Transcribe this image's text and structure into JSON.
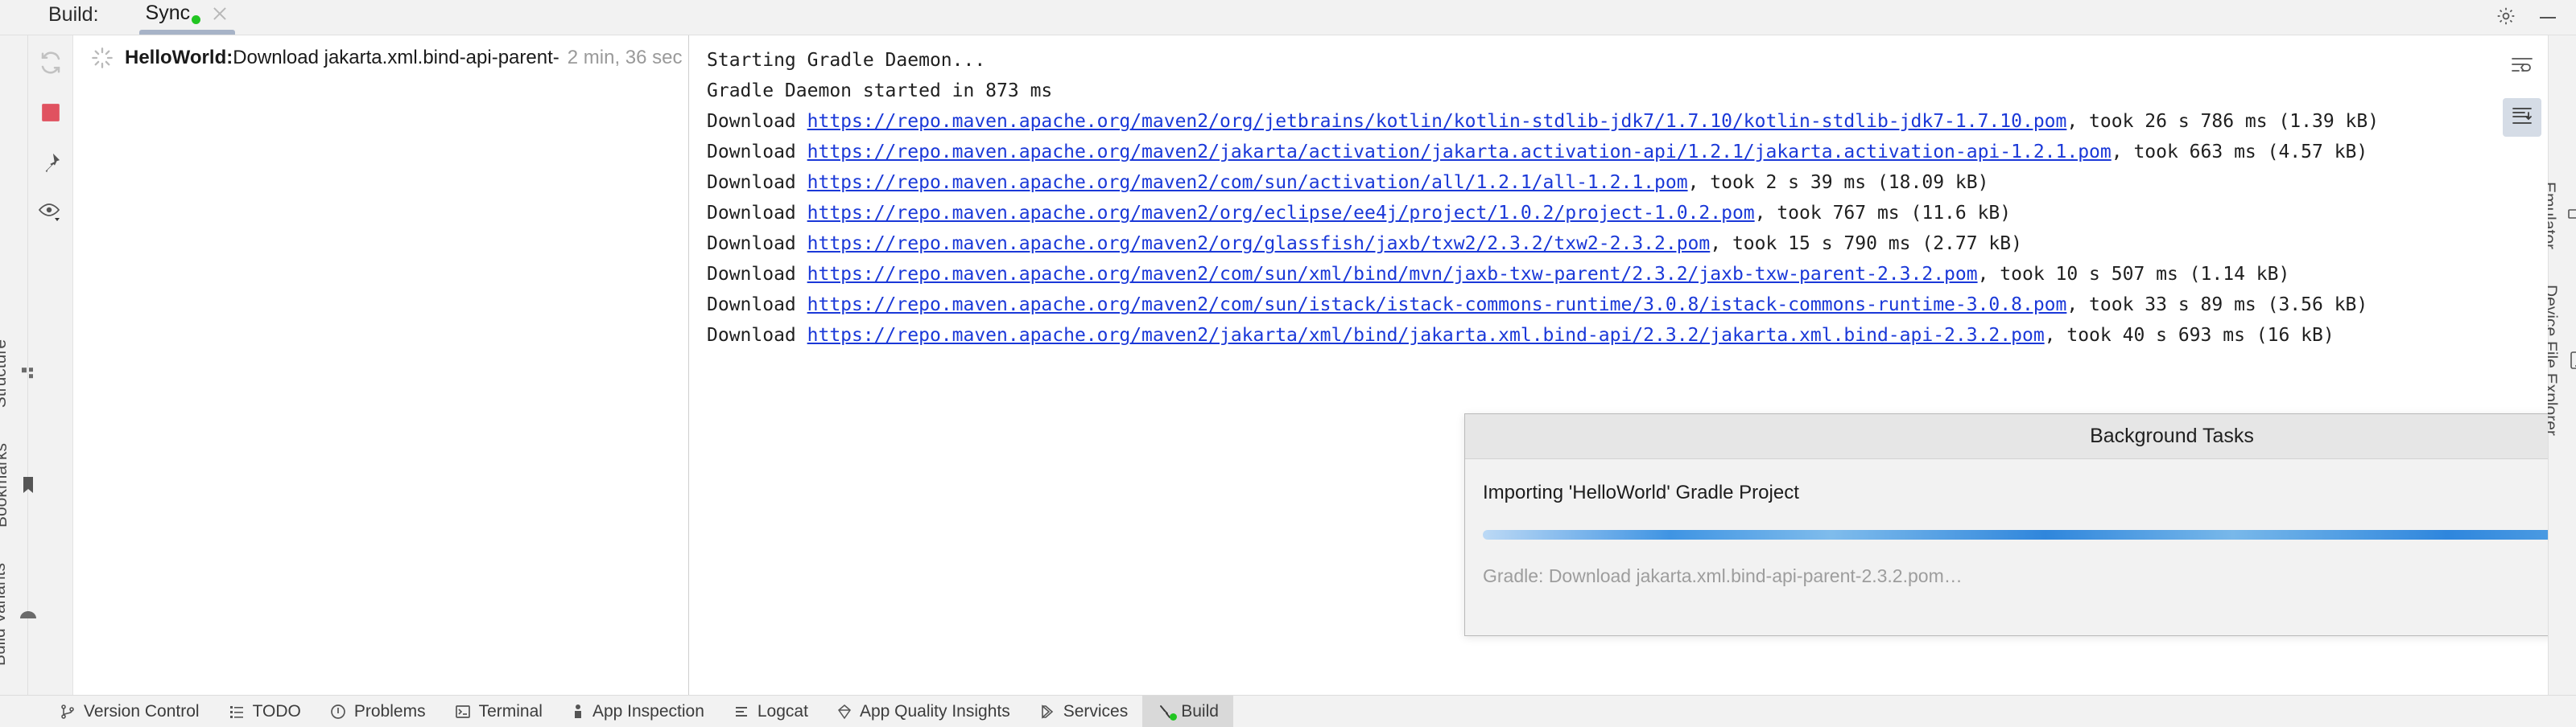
{
  "window": {
    "title_label": "Build:",
    "gear_icon": "gear-icon",
    "minimize_icon": "minimize-icon"
  },
  "tabs": [
    {
      "label": "Sync",
      "status": "running",
      "status_color": "#21c521",
      "close_icon": "close-icon",
      "active": true
    }
  ],
  "build_toolbar": [
    {
      "name": "restart-button",
      "icon": "restart-icon",
      "label": "Restart"
    },
    {
      "name": "stop-button",
      "icon": "stop-icon",
      "label": "Stop",
      "color": "#e05260"
    },
    {
      "name": "pin-button",
      "icon": "pin-icon",
      "label": "Pin Tab"
    },
    {
      "name": "filter-button",
      "icon": "eye-dropdown-icon",
      "label": "Show/Hide"
    }
  ],
  "tree": {
    "rows": [
      {
        "icon": "spinner-icon",
        "bold_text": "HelloWorld:",
        "text": " Download jakarta.xml.bind-api-parent-",
        "time": "2 min, 36 sec"
      }
    ]
  },
  "console": {
    "lines": [
      {
        "type": "plain",
        "text": "Starting Gradle Daemon..."
      },
      {
        "type": "plain",
        "text": "Gradle Daemon started in 873 ms"
      },
      {
        "type": "download",
        "prefix": "Download ",
        "url": "https://repo.maven.apache.org/maven2/org/jetbrains/kotlin/kotlin-stdlib-jdk7/1.7.10/kotlin-stdlib-jdk7-1.7.10.pom",
        "suffix": ", took 26 s 786 ms (1.39 kB)"
      },
      {
        "type": "download",
        "prefix": "Download ",
        "url": "https://repo.maven.apache.org/maven2/jakarta/activation/jakarta.activation-api/1.2.1/jakarta.activation-api-1.2.1.pom",
        "suffix": ", took 663 ms (4.57 kB)"
      },
      {
        "type": "download",
        "prefix": "Download ",
        "url": "https://repo.maven.apache.org/maven2/com/sun/activation/all/1.2.1/all-1.2.1.pom",
        "suffix": ", took 2 s 39 ms (18.09 kB)"
      },
      {
        "type": "download",
        "prefix": "Download ",
        "url": "https://repo.maven.apache.org/maven2/org/eclipse/ee4j/project/1.0.2/project-1.0.2.pom",
        "suffix": ", took 767 ms (11.6 kB)"
      },
      {
        "type": "download",
        "prefix": "Download ",
        "url": "https://repo.maven.apache.org/maven2/org/glassfish/jaxb/txw2/2.3.2/txw2-2.3.2.pom",
        "suffix": ", took 15 s 790 ms (2.77 kB)"
      },
      {
        "type": "download",
        "prefix": "Download ",
        "url": "https://repo.maven.apache.org/maven2/com/sun/xml/bind/mvn/jaxb-txw-parent/2.3.2/jaxb-txw-parent-2.3.2.pom",
        "suffix": ", took 10 s 507 ms (1.14 kB)"
      },
      {
        "type": "download",
        "prefix": "Download ",
        "url": "https://repo.maven.apache.org/maven2/com/sun/istack/istack-commons-runtime/3.0.8/istack-commons-runtime-3.0.8.pom",
        "suffix": ", took 33 s 89 ms (3.56 kB)"
      },
      {
        "type": "download",
        "prefix": "Download ",
        "url": "https://repo.maven.apache.org/maven2/jakarta/xml/bind/jakarta.xml.bind-api/2.3.2/jakarta.xml.bind-api-2.3.2.pom",
        "suffix": ", took 40 s 693 ms (16 kB)"
      }
    ],
    "right_toolbar": [
      {
        "name": "soft-wrap-button",
        "icon": "soft-wrap-icon",
        "selected": false
      },
      {
        "name": "scroll-to-end-button",
        "icon": "scroll-to-end-icon",
        "selected": true
      }
    ]
  },
  "background_tasks": {
    "title": "Background Tasks",
    "minimize_icon": "minimize-icon",
    "task_name": "Importing 'HelloWorld' Gradle Project",
    "cancel_icon": "cancel-icon",
    "status_text": "Gradle: Download jakarta.xml.bind-api-parent-2.3.2.pom…",
    "progress_color": "#2f86dc"
  },
  "left_stripe": [
    {
      "label": "Structure",
      "icon": "structure-icon"
    },
    {
      "label": "Bookmarks",
      "icon": "bookmark-icon"
    },
    {
      "label": "Build Variants",
      "icon": "android-icon"
    }
  ],
  "right_stripe": [
    {
      "label": "Emulator",
      "icon": "emulator-icon"
    },
    {
      "label": "Device File Explorer",
      "icon": "device-icon"
    }
  ],
  "status_bar": [
    {
      "label": "Version Control",
      "icon": "branch-icon",
      "active": false
    },
    {
      "label": "TODO",
      "icon": "list-icon",
      "active": false
    },
    {
      "label": "Problems",
      "icon": "warning-icon",
      "active": false
    },
    {
      "label": "Terminal",
      "icon": "terminal-icon",
      "active": false
    },
    {
      "label": "App Inspection",
      "icon": "inspection-icon",
      "active": false
    },
    {
      "label": "Logcat",
      "icon": "logcat-icon",
      "active": false
    },
    {
      "label": "App Quality Insights",
      "icon": "diamond-icon",
      "active": false
    },
    {
      "label": "Services",
      "icon": "services-icon",
      "active": false
    },
    {
      "label": "Build",
      "icon": "build-hammer-icon",
      "active": true,
      "status_dot": "#21c521"
    }
  ]
}
